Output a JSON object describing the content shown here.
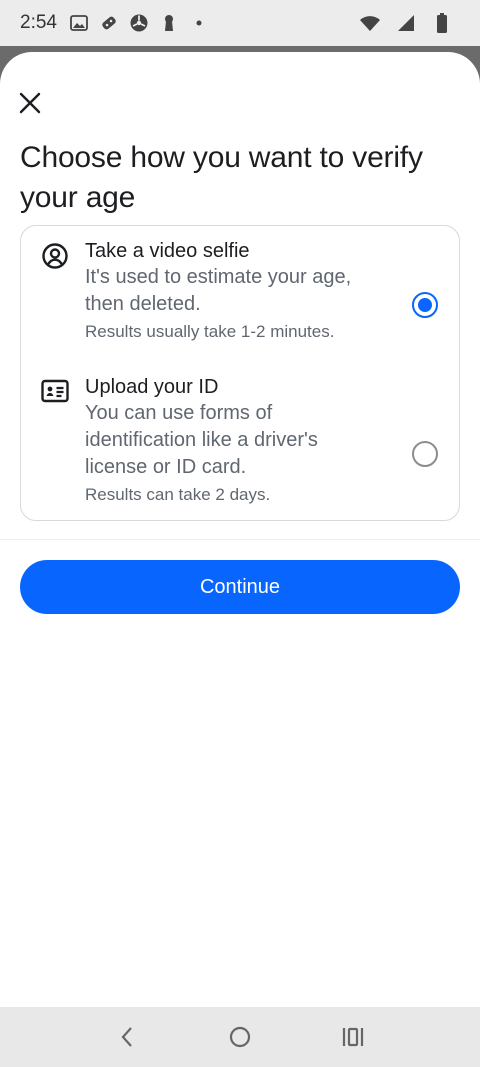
{
  "status_bar": {
    "time": "2:54",
    "left_icons": [
      "photo-icon",
      "gamepad-icon",
      "steering-icon",
      "keyhole-icon",
      "dot-icon"
    ],
    "right_icons": [
      "wifi-icon",
      "signal-icon",
      "battery-icon"
    ]
  },
  "sheet": {
    "title": "Choose how you want to verify your age",
    "options": [
      {
        "icon": "face-icon",
        "title": "Take a video selfie",
        "description": "It's used to estimate your age, then deleted.",
        "note": "Results usually take 1-2 minutes.",
        "selected": true
      },
      {
        "icon": "id-card-icon",
        "title": "Upload your ID",
        "description": "You can use forms of identification like a driver's license or ID card.",
        "note": "Results can take 2 days.",
        "selected": false
      }
    ],
    "continue_label": "Continue"
  },
  "colors": {
    "accent": "#0866ff",
    "text_primary": "#1c1e21",
    "text_secondary": "#606770"
  }
}
